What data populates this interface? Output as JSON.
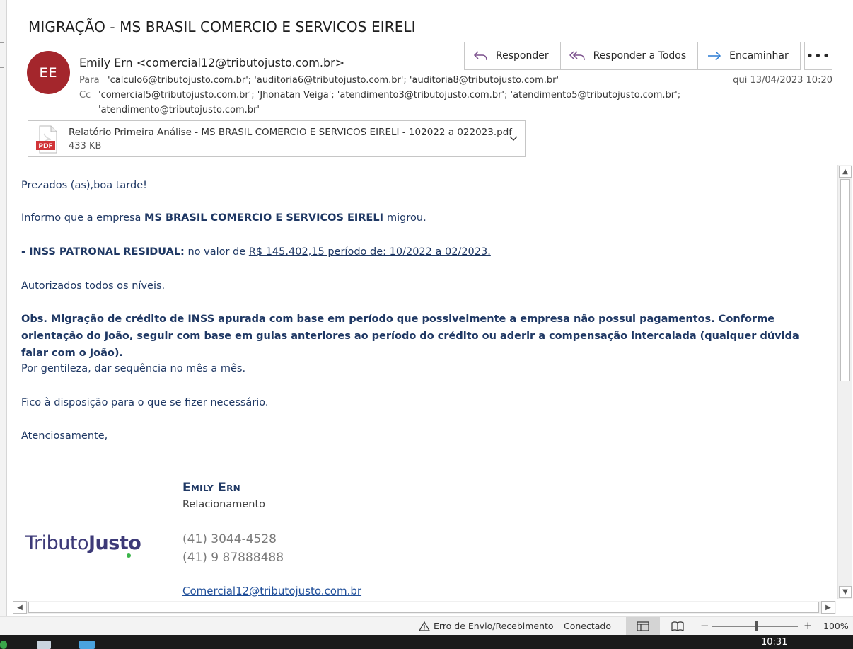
{
  "subject": "MIGRAÇÃO - MS BRASIL COMERCIO E SERVICOS EIRELI",
  "sender": {
    "initials": "EE",
    "avatar_color": "#a4262c",
    "display": "Emily Ern <comercial12@tributojusto.com.br>"
  },
  "recipients": {
    "to_label": "Para",
    "to": "'calculo6@tributojusto.com.br'; 'auditoria6@tributojusto.com.br'; 'auditoria8@tributojusto.com.br'",
    "cc_label": "Cc",
    "cc_line1": "'comercial5@tributojusto.com.br'; 'Jhonatan Veiga'; 'atendimento3@tributojusto.com.br'; 'atendimento5@tributojusto.com.br';",
    "cc_line2": "'atendimento@tributojusto.com.br'"
  },
  "date": "qui 13/04/2023 10:20",
  "actions": {
    "reply": "Responder",
    "reply_all": "Responder a Todos",
    "forward": "Encaminhar",
    "more": "•••"
  },
  "attachment": {
    "icon": "pdf-file-icon",
    "badge": "PDF",
    "name": "Relatório Primeira Análise - MS BRASIL COMERCIO E SERVICOS EIRELI - 102022 a 022023.pdf",
    "size": "433 KB"
  },
  "body": {
    "greeting": "Prezados (as),boa tarde!",
    "inform_prefix": "Informo que a empresa ",
    "inform_company": "MS BRASIL COMERCIO E SERVICOS EIRELI ",
    "inform_suffix": "migrou.",
    "inss_label": "- INSS PATRONAL RESIDUAL:",
    "inss_mid": " no valor de ",
    "inss_value": "R$ 145.402,15 período de: 10/2022  a 02/2023.",
    "authorized": "Autorizados todos os níveis.",
    "obs": "Obs. Migração de crédito de INSS apurada com base em período que possivelmente a empresa não possui pagamentos. Conforme orientação do João, seguir com base em guias anteriores ao período do crédito ou aderir a compensação intercalada (qualquer dúvida falar com o João).",
    "kindly": "Por gentileza, dar sequência no mês a mês.",
    "available": "Fico à disposição para o que se fizer necessário.",
    "regards": "Atenciosamente,"
  },
  "signature": {
    "name": "Emily Ern",
    "role": "Relacionamento",
    "phone1": "(41) 3044-4528",
    "phone2": "(41) 9 87888488",
    "email": "Comercial12@tributojusto.com.br",
    "logo_part1": "Tributo",
    "logo_part2": "Justo"
  },
  "status_bar": {
    "send_receive_error": "Erro de Envio/Recebimento",
    "connection": "Conectado",
    "zoom_minus": "−",
    "zoom_plus": "+",
    "zoom": "100%"
  },
  "taskbar": {
    "clock": "10:31"
  }
}
